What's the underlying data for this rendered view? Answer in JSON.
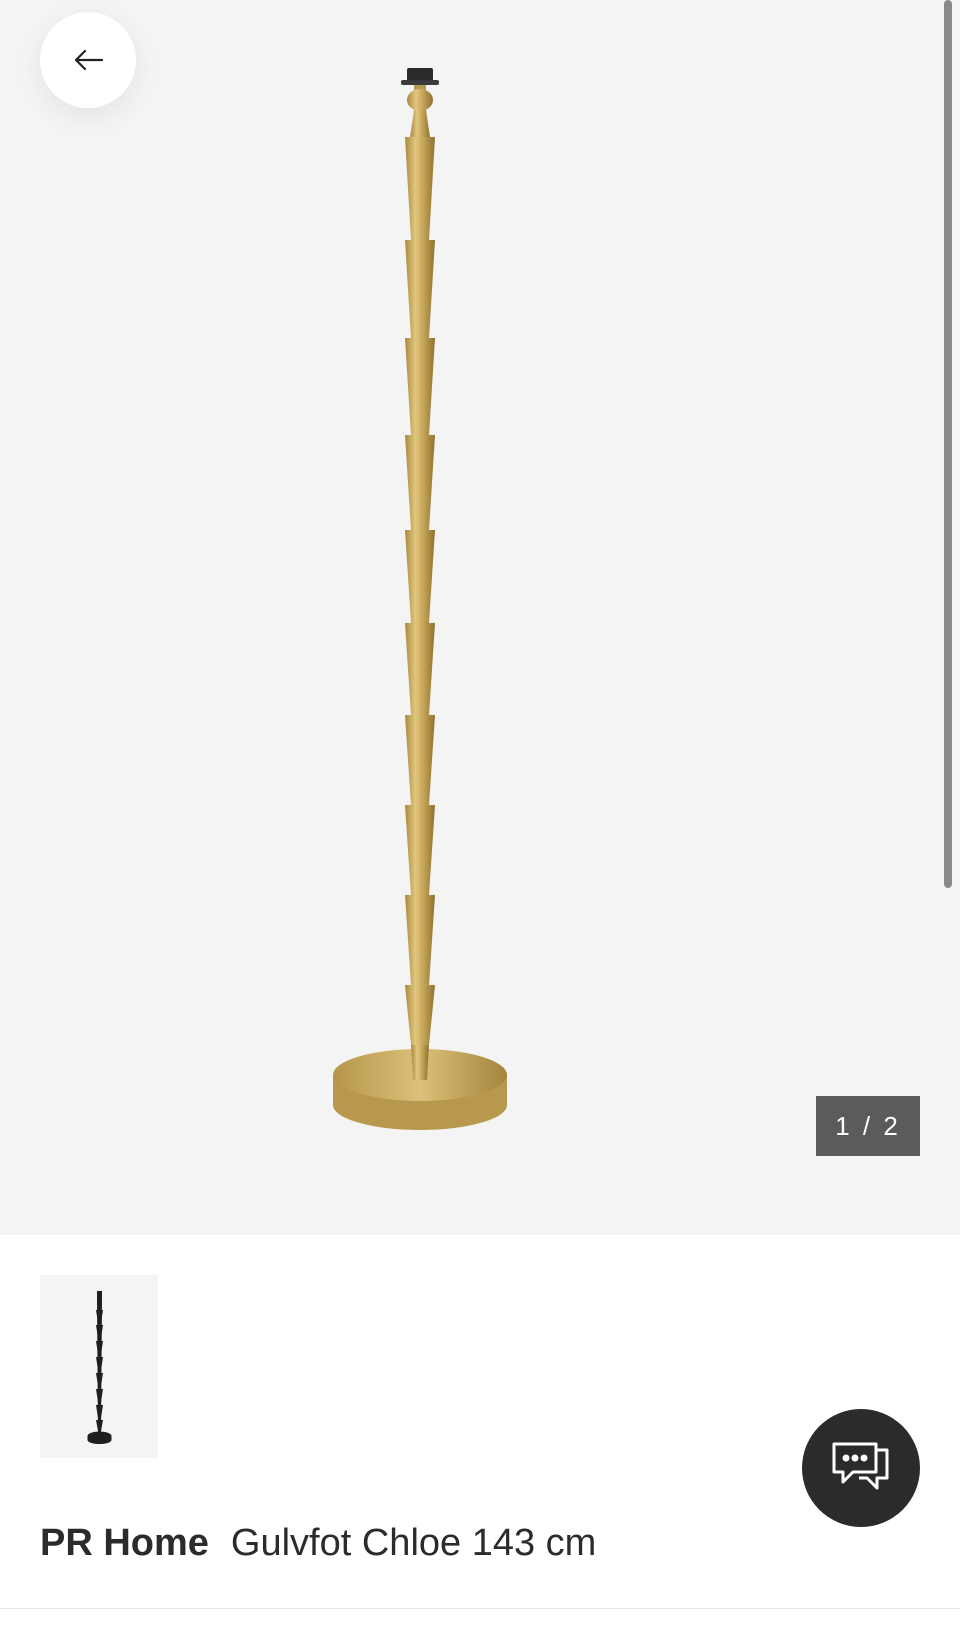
{
  "gallery": {
    "counter": "1 / 2",
    "current_index": 1,
    "total": 2,
    "images": [
      {
        "alt": "Gulvfot Chloe 143 cm",
        "color": "#c9a858"
      },
      {
        "alt": "Gulvfot Chloe 143 cm",
        "color": "#1f1f1f"
      }
    ]
  },
  "nav": {
    "back_icon": "arrow-left-icon"
  },
  "chat": {
    "icon": "chat-bubbles-icon"
  },
  "product": {
    "brand": "PR Home",
    "name": "Gulvfot Chloe 143 cm"
  },
  "colors": {
    "background": "#f4f4f4",
    "counter_bg": "#5b5b5b",
    "chat_bg": "#2b2b2b",
    "text": "#2b2b2b"
  }
}
